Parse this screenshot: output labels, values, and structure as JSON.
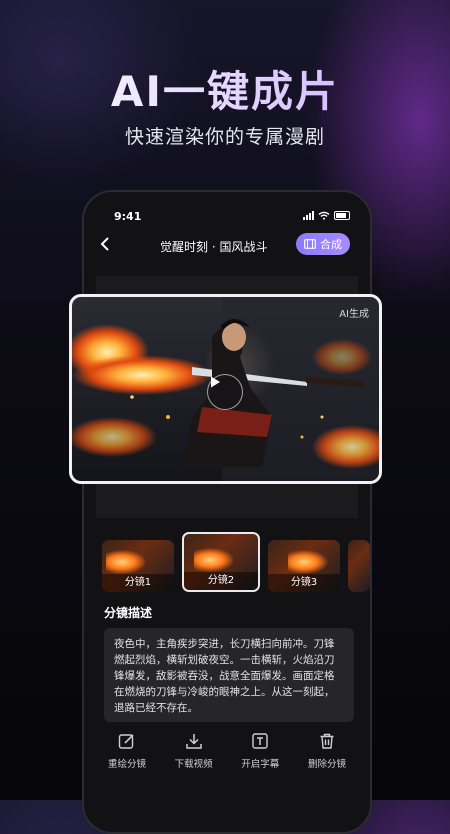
{
  "promo": {
    "headline": "AI一键成片",
    "subhead": "快速渲染你的专属漫剧"
  },
  "status_bar": {
    "time": "9:41"
  },
  "nav": {
    "title": "觉醒时刻 · 国风战斗",
    "merge_label": "合成"
  },
  "hero": {
    "ai_tag": "AI生成"
  },
  "storyboard": {
    "thumbs": [
      {
        "label": "分镜1"
      },
      {
        "label": "分镜2",
        "selected": true
      },
      {
        "label": "分镜3"
      }
    ]
  },
  "description": {
    "title": "分镜描述",
    "text": "夜色中，主角疾步突进，长刀横扫向前冲。刀锋燃起烈焰，横斩划破夜空。一击横斩，火焰沿刀锋爆发，敌影被吞没，战意全面爆发。画面定格在燃烧的刀锋与冷峻的眼神之上。从这一刻起，退路已经不存在。"
  },
  "actions": [
    {
      "label": "重绘分镜",
      "icon": "edit-icon"
    },
    {
      "label": "下载视频",
      "icon": "download-icon"
    },
    {
      "label": "开启字幕",
      "icon": "subtitle-icon"
    },
    {
      "label": "删除分镜",
      "icon": "trash-icon"
    }
  ],
  "colors": {
    "accent": "#9a85ff",
    "panel": "#26262a",
    "background": "#0c0b14"
  }
}
